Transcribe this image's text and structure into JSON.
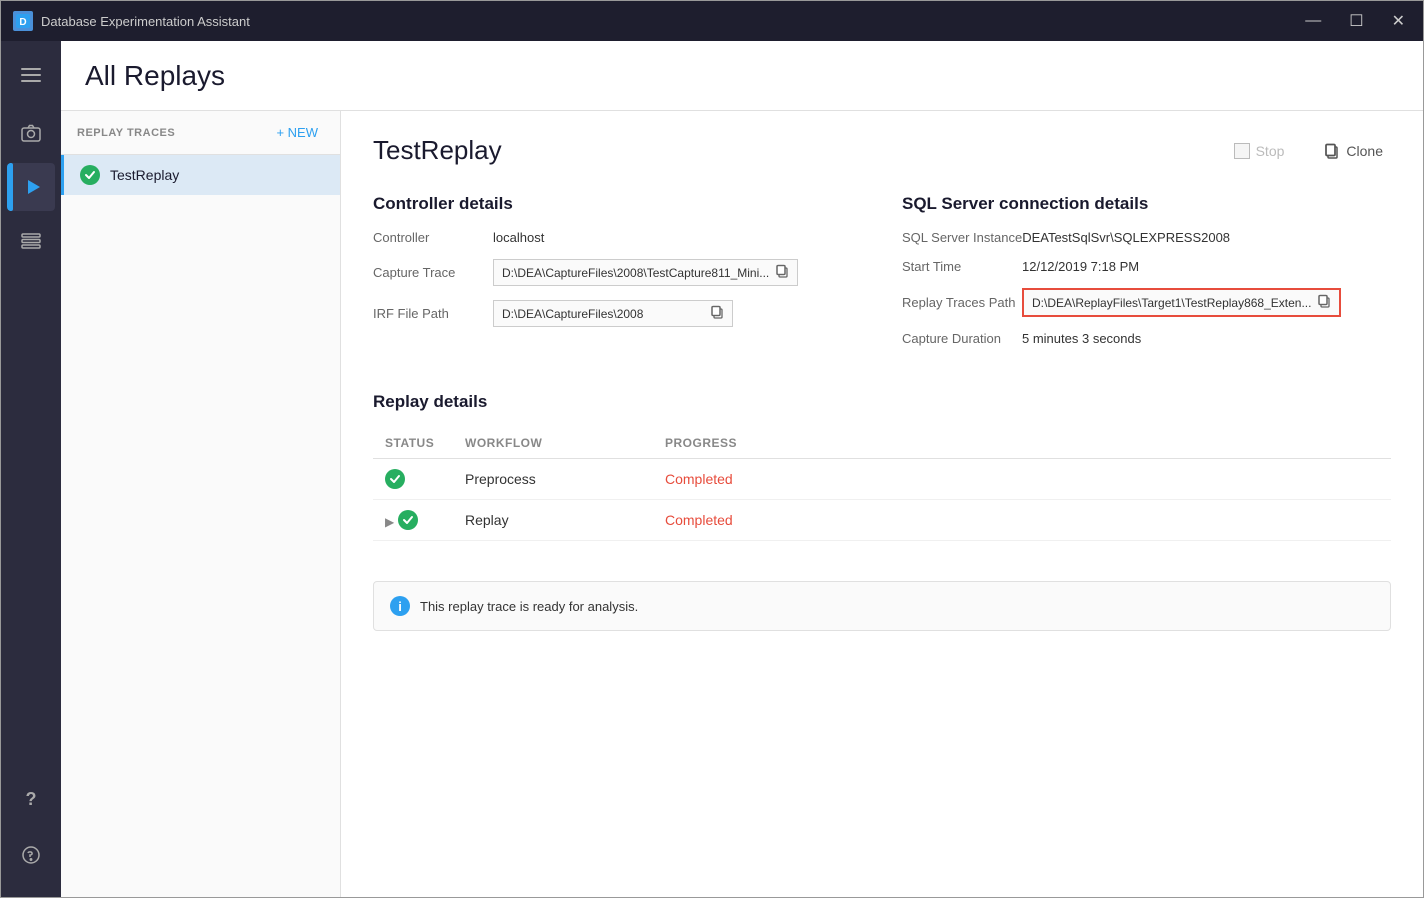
{
  "app": {
    "title": "Database Experimentation Assistant",
    "icon_letter": "D"
  },
  "titlebar": {
    "minimize": "—",
    "maximize": "☐",
    "close": "✕"
  },
  "header": {
    "title": "All Replays"
  },
  "nav": {
    "items": [
      {
        "id": "menu",
        "symbol": "☰",
        "active": false
      },
      {
        "id": "camera",
        "symbol": "📷",
        "active": false
      },
      {
        "id": "replay",
        "symbol": "▶",
        "active": true
      },
      {
        "id": "list",
        "symbol": "☰",
        "active": false
      }
    ],
    "bottom": [
      {
        "id": "help",
        "symbol": "?"
      },
      {
        "id": "face",
        "symbol": "☺"
      }
    ]
  },
  "traces_panel": {
    "header_label": "REPLAY TRACES",
    "new_button": "+ NEW",
    "items": [
      {
        "name": "TestReplay",
        "active": true
      }
    ]
  },
  "detail": {
    "title": "TestReplay",
    "actions": {
      "stop_label": "Stop",
      "clone_label": "Clone"
    },
    "controller_section": {
      "title": "Controller details",
      "fields": [
        {
          "label": "Controller",
          "value": "localhost",
          "type": "text"
        },
        {
          "label": "Capture Trace",
          "value": "D:\\DEA\\CaptureFiles\\2008\\TestCapture811_Mini...",
          "type": "input",
          "copy": true
        },
        {
          "label": "IRF File Path",
          "value": "D:\\DEA\\CaptureFiles\\2008",
          "type": "input",
          "copy": true
        }
      ]
    },
    "sql_section": {
      "title": "SQL Server connection details",
      "fields": [
        {
          "label": "SQL Server Instance",
          "value": "DEATestSqlSvr\\SQLEXPRESS2008",
          "type": "text"
        },
        {
          "label": "Start Time",
          "value": "12/12/2019 7:18 PM",
          "type": "text"
        },
        {
          "label": "Replay Traces Path",
          "value": "D:\\DEA\\ReplayFiles\\Target1\\TestReplay868_Exten...",
          "type": "input",
          "copy": true,
          "highlighted": true
        },
        {
          "label": "Capture Duration",
          "value": "5 minutes 3 seconds",
          "type": "text"
        }
      ]
    },
    "replay_section": {
      "title": "Replay details",
      "columns": [
        "STATUS",
        "WORKFLOW",
        "PROGRESS"
      ],
      "rows": [
        {
          "play": false,
          "status": "green",
          "workflow": "Preprocess",
          "progress": "Completed"
        },
        {
          "play": true,
          "status": "green",
          "workflow": "Replay",
          "progress": "Completed"
        }
      ]
    },
    "info_bar": {
      "message": "This replay trace is ready for analysis."
    }
  }
}
